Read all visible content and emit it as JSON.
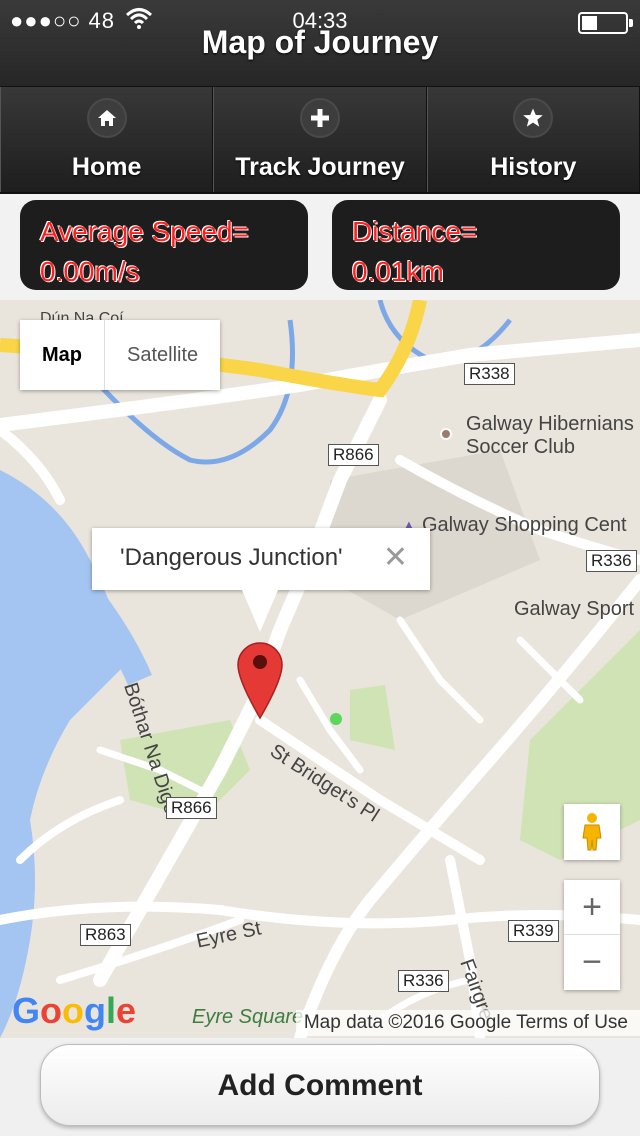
{
  "status_bar": {
    "signal": "●●●○○ 48",
    "time": "04:33",
    "battery_level": 0.35
  },
  "header": {
    "title": "Map of Journey"
  },
  "nav": [
    {
      "label": "Home",
      "icon": "home-icon"
    },
    {
      "label": "Track Journey",
      "icon": "plus-icon"
    },
    {
      "label": "History",
      "icon": "star-icon"
    }
  ],
  "stats": {
    "speed": {
      "line1": "Average Speed=",
      "line2": "0.00m/s"
    },
    "distance": {
      "line1": "Distance=",
      "line2": "0.01km"
    }
  },
  "map": {
    "map_type": {
      "map": "Map",
      "satellite": "Satellite"
    },
    "info_window": {
      "text": "'Dangerous Junction'",
      "close": "✕"
    },
    "labels": {
      "dun_na_coi": "Dún Na Coí",
      "galway_hibernians": "Galway Hibernians",
      "soccer_club": "Soccer Club",
      "galway_shopping": "Galway Shopping Cent",
      "galway_sport": "Galway Sport",
      "bothar_na_dige": "Bóthar Na Dige",
      "st_bridgets": "St Bridget's Pl",
      "eyre_st": "Eyre St",
      "eyre_square": "Eyre Square",
      "fairgreen": "Fairgre"
    },
    "shields": {
      "r338": "R338",
      "r866_top": "R866",
      "r336_right": "R336",
      "r866_bottom": "R866",
      "r863": "R863",
      "r339": "R339",
      "r336_bottom": "R336"
    },
    "zoom": {
      "in": "+",
      "out": "−"
    },
    "logo": "Google",
    "attribution": "Map data ©2016 Google   Terms of Use"
  },
  "bottom": {
    "add_comment": "Add Comment"
  },
  "colors": {
    "stat_text": "#ff1f1f",
    "marker": "#e53935",
    "water": "#a4c4f2",
    "motorway": "#f9d547"
  }
}
